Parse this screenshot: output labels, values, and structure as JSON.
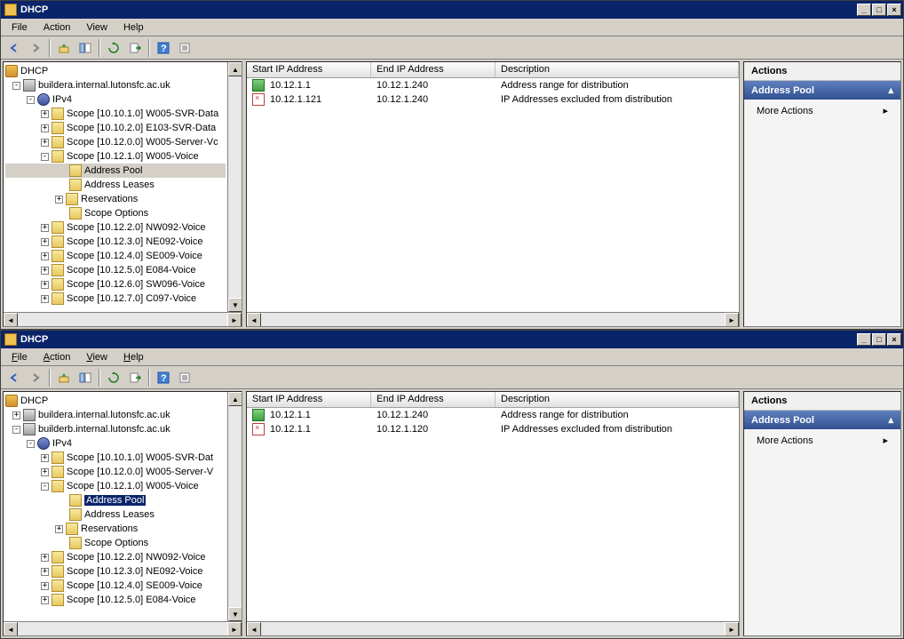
{
  "win1": {
    "title": "DHCP",
    "menu": [
      "File",
      "Action",
      "View",
      "Help"
    ],
    "tree": {
      "root": "DHCP",
      "server": "buildera.internal.lutonsfc.ac.uk",
      "ipv4": "IPv4",
      "scopes": [
        "Scope [10.10.1.0] W005-SVR-Data",
        "Scope [10.10.2.0] E103-SVR-Data",
        "Scope [10.12.0.0] W005-Server-Vc",
        "Scope [10.12.1.0] W005-Voice",
        "Scope [10.12.2.0] NW092-Voice",
        "Scope [10.12.3.0] NE092-Voice",
        "Scope [10.12.4.0] SE009-Voice",
        "Scope [10.12.5.0] E084-Voice",
        "Scope [10.12.6.0] SW096-Voice",
        "Scope [10.12.7.0] C097-Voice"
      ],
      "sub": [
        "Address Pool",
        "Address Leases",
        "Reservations",
        "Scope Options"
      ]
    },
    "list": {
      "cols": [
        "Start IP Address",
        "End IP Address",
        "Description"
      ],
      "rows": [
        {
          "start": "10.12.1.1",
          "end": "10.12.1.240",
          "desc": "Address range for distribution",
          "icon": "range"
        },
        {
          "start": "10.12.1.121",
          "end": "10.12.1.240",
          "desc": "IP Addresses excluded from distribution",
          "icon": "excl"
        }
      ]
    },
    "actions": {
      "title": "Actions",
      "section": "Address Pool",
      "items": [
        "More Actions"
      ]
    }
  },
  "win2": {
    "title": "DHCP",
    "menu": [
      "File",
      "Action",
      "View",
      "Help"
    ],
    "tree": {
      "root": "DHCP",
      "server1": "buildera.internal.lutonsfc.ac.uk",
      "server2": "builderb.internal.lutonsfc.ac.uk",
      "ipv4": "IPv4",
      "scopes": [
        "Scope [10.10.1.0] W005-SVR-Dat",
        "Scope [10.12.0.0] W005-Server-V",
        "Scope [10.12.1.0] W005-Voice",
        "Scope [10.12.2.0] NW092-Voice",
        "Scope [10.12.3.0] NE092-Voice",
        "Scope [10.12.4.0] SE009-Voice",
        "Scope [10.12.5.0] E084-Voice"
      ],
      "sub": [
        "Address Pool",
        "Address Leases",
        "Reservations",
        "Scope Options"
      ]
    },
    "list": {
      "cols": [
        "Start IP Address",
        "End IP Address",
        "Description"
      ],
      "rows": [
        {
          "start": "10.12.1.1",
          "end": "10.12.1.240",
          "desc": "Address range for distribution",
          "icon": "range"
        },
        {
          "start": "10.12.1.1",
          "end": "10.12.1.120",
          "desc": "IP Addresses excluded from distribution",
          "icon": "excl"
        }
      ]
    },
    "actions": {
      "title": "Actions",
      "section": "Address Pool",
      "items": [
        "More Actions"
      ]
    }
  }
}
